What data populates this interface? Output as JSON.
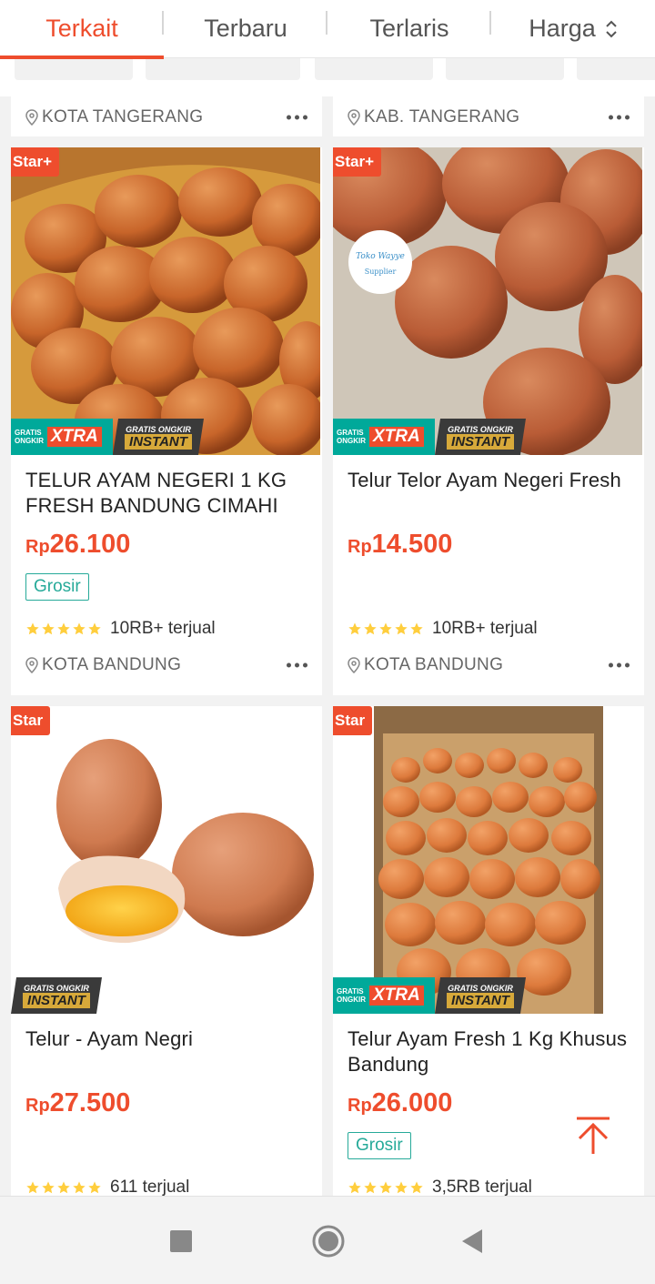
{
  "tabs": [
    {
      "label": "Terkait",
      "active": true
    },
    {
      "label": "Terbaru",
      "active": false
    },
    {
      "label": "Terlaris",
      "active": false
    },
    {
      "label": "Harga",
      "active": false
    }
  ],
  "top_partial_cards": [
    {
      "location": "KOTA TANGERANG"
    },
    {
      "location": "KAB. TANGERANG"
    }
  ],
  "products": [
    {
      "badge": "Star+",
      "title": "TELUR AYAM NEGERI 1 KG FRESH BANDUNG CIMAHI",
      "currency": "Rp",
      "price": "26.100",
      "grosir": "Grosir",
      "sold": "10RB+ terjual",
      "location": "KOTA BANDUNG",
      "shipping_xtra": true,
      "shipping_instant": true
    },
    {
      "badge": "Star+",
      "title": "Telur Telor Ayam Negeri Fresh",
      "currency": "Rp",
      "price": "14.500",
      "grosir": "",
      "sold": "10RB+ terjual",
      "location": "KOTA BANDUNG",
      "shipping_xtra": true,
      "shipping_instant": true
    },
    {
      "badge": "Star",
      "title": "Telur - Ayam Negri",
      "currency": "Rp",
      "price": "27.500",
      "grosir": "",
      "sold": "611 terjual",
      "location": "",
      "shipping_xtra": false,
      "shipping_instant": true
    },
    {
      "badge": "Star",
      "title": "Telur Ayam Fresh 1 Kg Khusus Bandung",
      "currency": "Rp",
      "price": "26.000",
      "grosir": "Grosir",
      "sold": "3,5RB terjual",
      "location": "",
      "shipping_xtra": true,
      "shipping_instant": true
    }
  ],
  "shipping": {
    "xtra_small": "GRATIS ONGKIR",
    "xtra_big": "XTRA",
    "instant_small": "GRATIS ONGKIR",
    "instant_big": "INSTANT"
  },
  "colors": {
    "accent": "#ee4d2d",
    "grosir": "#26aa99",
    "star": "#ffce3d"
  }
}
